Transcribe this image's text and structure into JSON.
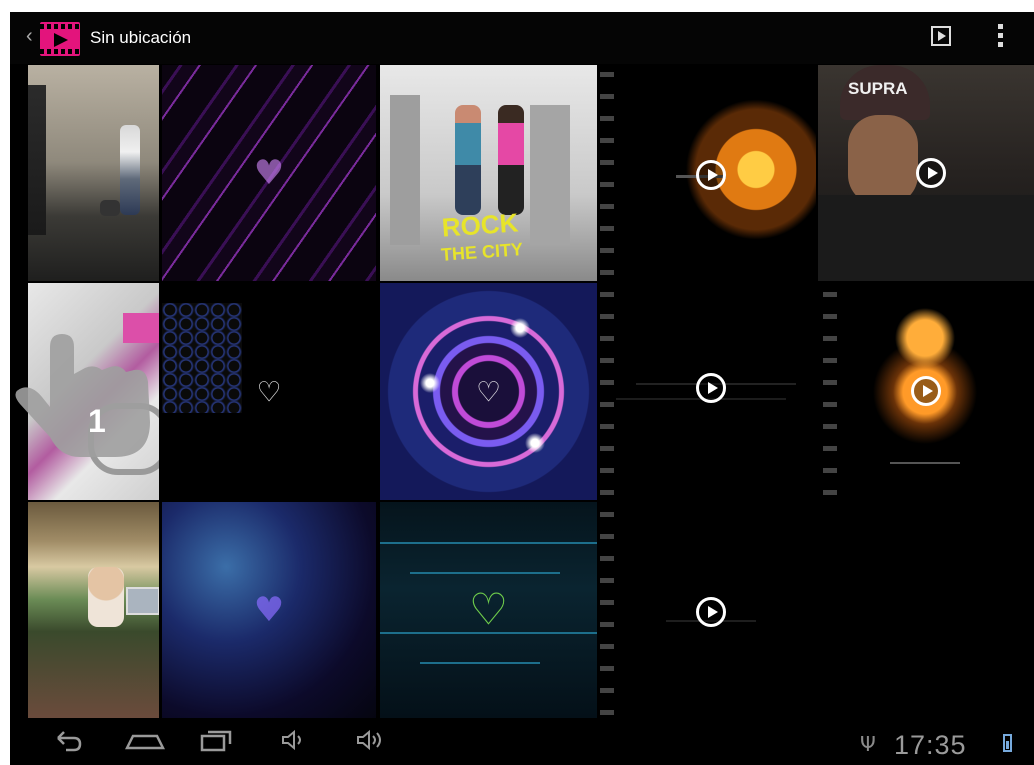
{
  "actionbar": {
    "title": "Sin ubicación",
    "back_icon": "chevron-left-icon",
    "app_icon": "video-gallery-icon",
    "slideshow_icon": "slideshow-play-icon",
    "overflow_icon": "overflow-menu-icon"
  },
  "grid": {
    "tiles": [
      {
        "kind": "photo",
        "subject": "woman-walking-dog"
      },
      {
        "kind": "wallpaper",
        "subject": "purple-streaks-heart",
        "icon": "heart-icon"
      },
      {
        "kind": "photo",
        "subject": "rock-the-city-poster",
        "caption_line1": "ROCK",
        "caption_line2": "THE CITY"
      },
      {
        "kind": "video",
        "subject": "orange-lights",
        "icon": "play-icon"
      },
      {
        "kind": "video",
        "subject": "supra-cap-boy",
        "cap_text": "SUPRA",
        "icon": "play-icon"
      },
      {
        "kind": "photo",
        "subject": "woman-pink-top"
      },
      {
        "kind": "wallpaper",
        "subject": "hexagon-grid-heart",
        "icon": "heart-icon"
      },
      {
        "kind": "wallpaper",
        "subject": "neon-circle-heart",
        "icon": "heart-icon"
      },
      {
        "kind": "video",
        "subject": "dark-text-intro",
        "icon": "play-icon"
      },
      {
        "kind": "video",
        "subject": "orange-orb-intro",
        "icon": "play-icon"
      },
      {
        "kind": "photo",
        "subject": "couple-in-car"
      },
      {
        "kind": "wallpaper",
        "subject": "blue-smoke-heart",
        "icon": "heart-icon"
      },
      {
        "kind": "wallpaper",
        "subject": "circuit-heart",
        "icon": "heart-icon"
      },
      {
        "kind": "video",
        "subject": "dark-intro-2",
        "icon": "play-icon"
      }
    ]
  },
  "tutorial": {
    "hand_icon": "tap-hand-icon",
    "step_number": "1"
  },
  "navbar": {
    "back_icon": "back-arrow-icon",
    "home_icon": "home-icon",
    "recents_icon": "recent-apps-icon",
    "vol_down_icon": "volume-down-icon",
    "vol_up_icon": "volume-up-icon",
    "usb_icon": "usb-icon",
    "clock": "17:35",
    "battery_icon": "battery-icon"
  },
  "colors": {
    "accent": "#e3147c",
    "status_text": "#9a9a9a",
    "background": "#000000"
  }
}
